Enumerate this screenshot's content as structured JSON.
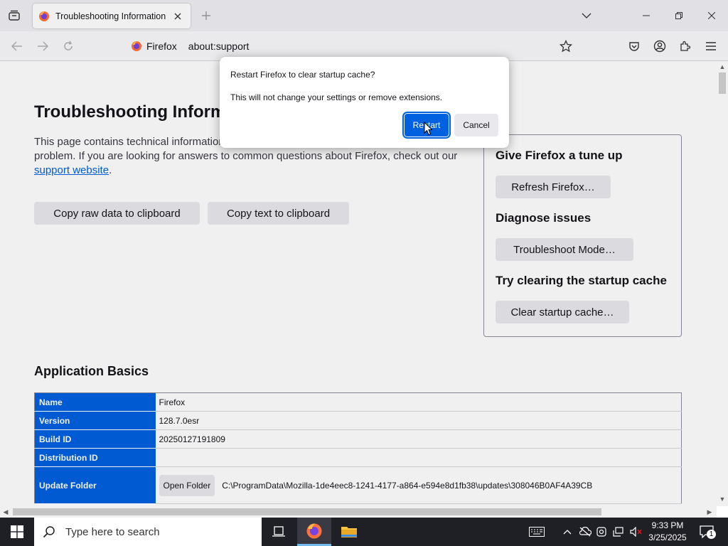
{
  "tab": {
    "title": "Troubleshooting Information"
  },
  "urlbar": {
    "identity": "Firefox",
    "url": "about:support"
  },
  "page": {
    "title": "Troubleshooting Information",
    "intro_text": "This page contains technical information that might be useful when you're trying to solve a problem. If you are looking for answers to common questions about Firefox, check out our ",
    "support_link": "support website",
    "intro_end": ".",
    "copy_raw": "Copy raw data to clipboard",
    "copy_text": "Copy text to clipboard"
  },
  "sidebox": {
    "tune_title": "Give Firefox a tune up",
    "refresh_btn": "Refresh Firefox…",
    "diagnose_title": "Diagnose issues",
    "troubleshoot_btn": "Troubleshoot Mode…",
    "cache_title": "Try clearing the startup cache",
    "cache_btn": "Clear startup cache…"
  },
  "basics": {
    "title": "Application Basics",
    "rows": [
      {
        "label": "Name",
        "value": "Firefox"
      },
      {
        "label": "Version",
        "value": "128.7.0esr"
      },
      {
        "label": "Build ID",
        "value": "20250127191809"
      },
      {
        "label": "Distribution ID",
        "value": ""
      },
      {
        "label": "Update Folder",
        "button": "Open Folder",
        "value": "C:\\ProgramData\\Mozilla-1de4eec8-1241-4177-a864-e594e8d1fb38\\updates\\308046B0AF4A39CB"
      }
    ]
  },
  "dialog": {
    "title": "Restart Firefox to clear startup cache?",
    "message": "This will not change your settings or remove extensions.",
    "restart": "Restart",
    "cancel": "Cancel"
  },
  "taskbar": {
    "search_placeholder": "Type here to search",
    "time": "9:33 PM",
    "date": "3/25/2025",
    "notification_count": "1"
  },
  "colors": {
    "accent": "#0061e0",
    "taskbar": "#1f1f26"
  }
}
